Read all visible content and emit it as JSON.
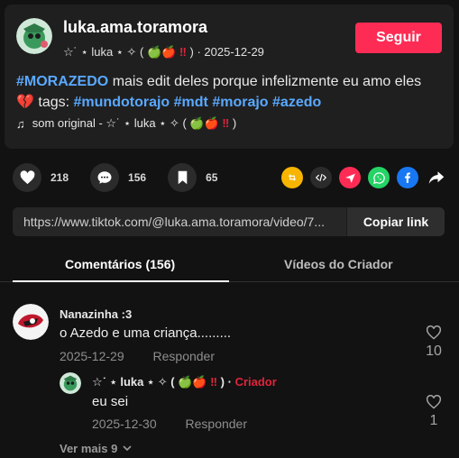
{
  "post": {
    "username": "luka.ama.toramora",
    "display_name_prefix": "☆˙ ⋆ luka ⋆ ✧ ( 🍏🍎",
    "display_name_mark": "‼",
    "display_name_suffix": ")",
    "date": "2025-12-29",
    "follow_label": "Seguir",
    "desc_hashtag": "#MORAZEDO",
    "desc_text": "mais edit deles porque infelizmente eu amo eles",
    "broken_heart": "💔",
    "tags_label": "tags:",
    "tags": [
      "#mundotorajo",
      "#mdt",
      "#morajo",
      "#azedo"
    ],
    "music_prefix": "som original - ☆˙ ⋆ luka ⋆ ✧ ( 🍏🍎",
    "music_mark": "‼",
    "music_suffix": ")"
  },
  "actions": {
    "likes": "218",
    "comments": "156",
    "saves": "65"
  },
  "share_icons": [
    "repost-icon",
    "embed-icon",
    "send-icon",
    "whatsapp-icon",
    "facebook-icon",
    "share-arrow-icon"
  ],
  "colors": {
    "accent": "#fe2c55",
    "hashtag": "#5aa9ff",
    "repost": "#f7b500",
    "whatsapp": "#25d366",
    "facebook": "#1877f2"
  },
  "link": {
    "url": "https://www.tiktok.com/@luka.ama.toramora/video/7...",
    "copy_label": "Copiar link"
  },
  "tabs": [
    {
      "label": "Comentários (156)"
    },
    {
      "label": "Vídeos do Criador"
    }
  ],
  "comments": [
    {
      "user": "Nanazinha :3",
      "text": "o Azedo e uma criança.........",
      "date": "2025-12-29",
      "reply_label": "Responder",
      "likes": "10"
    }
  ],
  "reply": {
    "user_prefix": "☆˙ ⋆ luka ⋆ ✧ ( 🍏🍎",
    "user_mark": "‼",
    "user_suffix": ") ·",
    "creator_label": "Criador",
    "text": "eu sei",
    "date": "2025-12-30",
    "reply_label": "Responder",
    "likes": "1"
  },
  "more_label": "Ver mais 9"
}
